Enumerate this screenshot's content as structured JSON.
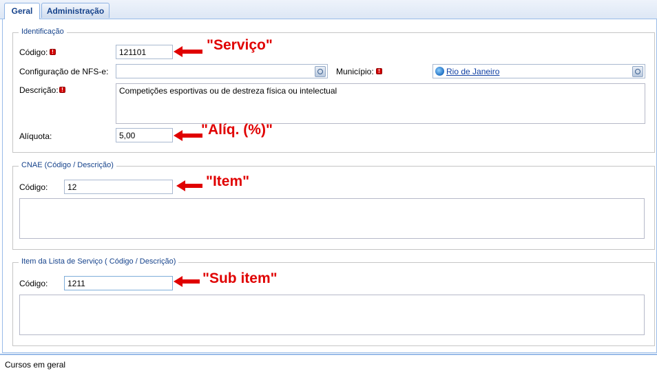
{
  "tabs": [
    {
      "label": "Geral",
      "active": true
    },
    {
      "label": "Administração",
      "active": false
    }
  ],
  "identificacao": {
    "legend": "Identificação",
    "codigo_label": "Código:",
    "codigo_value": "121101",
    "config_label": "Configuração de NFS-e:",
    "config_value": "",
    "municipio_label": "Município:",
    "municipio_value": "Rio de Janeiro",
    "descricao_label": "Descrição:",
    "descricao_value": "Competições esportivas ou de destreza física ou intelectual",
    "aliquota_label": "Alíquota:",
    "aliquota_value": "5,00"
  },
  "cnae": {
    "legend": "CNAE (Código / Descrição)",
    "codigo_label": "Código:",
    "codigo_value": "12",
    "descricao_value": ""
  },
  "item_lista": {
    "legend": "Item da Lista de Serviço ( Código / Descrição)",
    "codigo_label": "Código:",
    "codigo_value": "1211",
    "descricao_value": ""
  },
  "annotations": {
    "servico": "\"Serviço\"",
    "aliq": "\"Alíq. (%)\"",
    "item": "\"Item\"",
    "sub_item": "\"Sub item\""
  },
  "status": {
    "text": "Cursos em geral"
  },
  "colors": {
    "annotation": "#e00000",
    "required": "#d40000",
    "accent": "#15428b"
  },
  "icons": {
    "required": "required-icon",
    "lookup": "search-lookup-icon",
    "globe": "globe-icon",
    "arrow": "arrow-left-icon"
  }
}
